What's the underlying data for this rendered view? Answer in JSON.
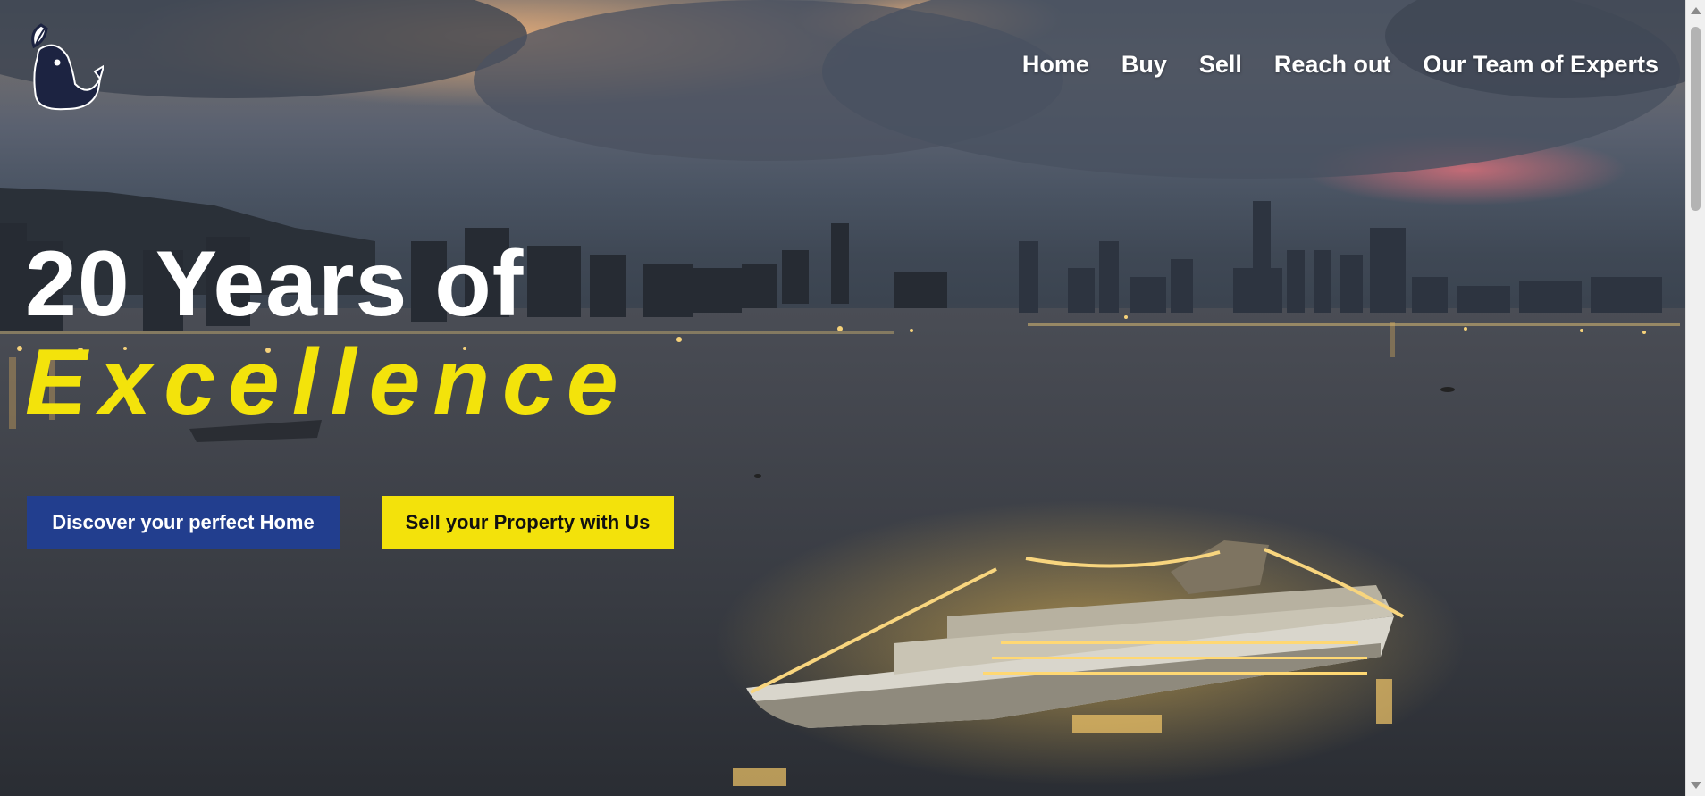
{
  "nav": {
    "items": [
      {
        "label": "Home"
      },
      {
        "label": "Buy"
      },
      {
        "label": "Sell"
      },
      {
        "label": "Reach out"
      },
      {
        "label": "Our Team of Experts"
      }
    ]
  },
  "hero": {
    "headline_line1": "20 Years of",
    "headline_line2": "Excellence",
    "primary_button": "Discover your perfect Home",
    "secondary_button": "Sell your Property with Us"
  },
  "colors": {
    "accent_yellow": "#f3e20b",
    "button_blue": "#223e8e",
    "logo_navy": "#1c2341"
  },
  "icons": {
    "logo": "whale-with-leaf-logo"
  }
}
